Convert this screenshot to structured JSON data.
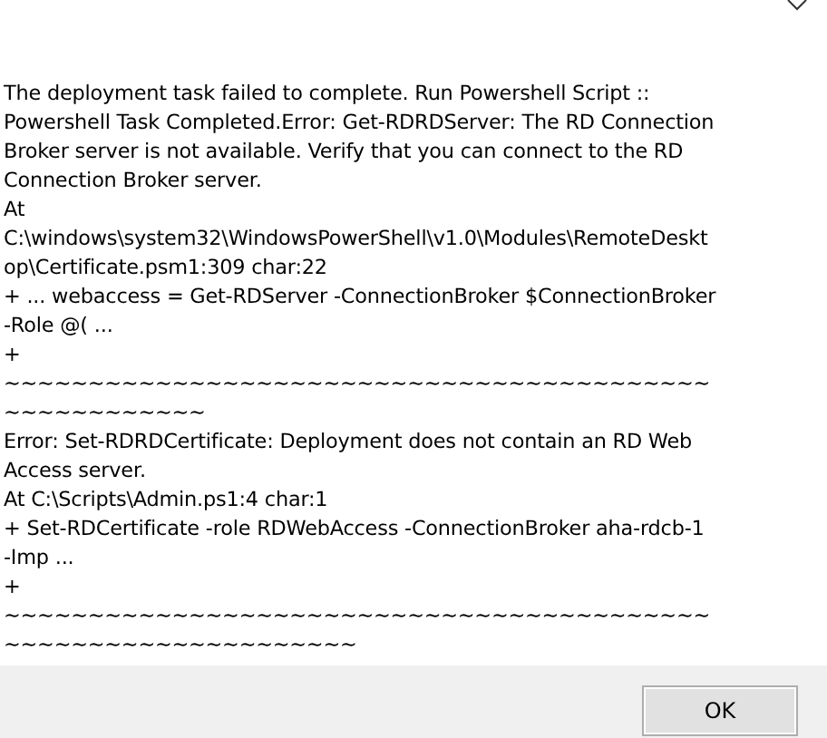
{
  "dialog": {
    "message_lines": [
      "The deployment task failed to complete. Run Powershell Script ::",
      "Powershell Task Completed.Error: Get-RDRDServer: The RD Connection",
      "Broker server is not available. Verify that you can connect to the RD",
      "Connection Broker server.",
      "At",
      "C:\\windows\\system32\\WindowsPowerShell\\v1.0\\Modules\\RemoteDeskt",
      "op\\Certificate.psm1:309 char:22",
      "+ ... webaccess = Get-RDServer -ConnectionBroker $ConnectionBroker",
      "-Role @( ...",
      "+",
      "~~~~~~~~~~~~~~~~~~~~~~~~~~~~~~~~~~~~~~~~~~",
      "~~~~~~~~~~~~",
      "Error: Set-RDRDCertificate: Deployment does not contain an RD Web",
      "Access server.",
      "At C:\\Scripts\\Admin.ps1:4 char:1",
      "+ Set-RDCertificate -role RDWebAccess -ConnectionBroker aha-rdcb-1",
      "-Imp ...",
      "+",
      "~~~~~~~~~~~~~~~~~~~~~~~~~~~~~~~~~~~~~~~~~~",
      "~~~~~~~~~~~~~~~~~~~~~"
    ],
    "buttons": [
      "OK"
    ]
  }
}
